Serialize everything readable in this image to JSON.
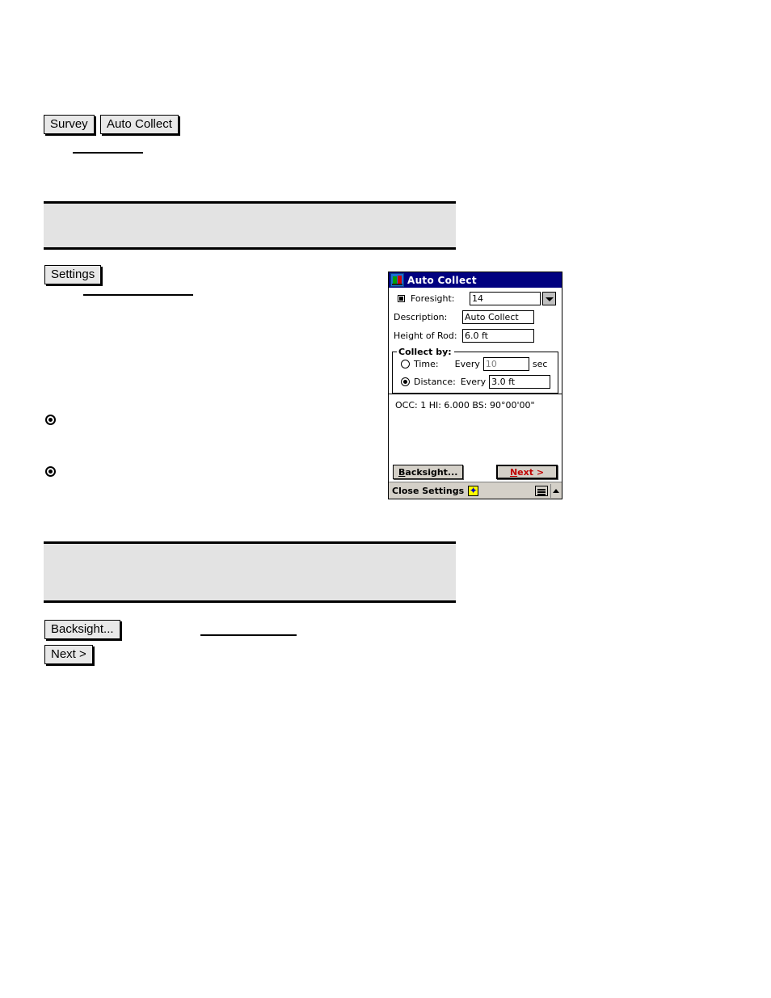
{
  "document": {
    "breadcrumb_buttons": [
      {
        "label": "Survey",
        "name": "survey-button"
      },
      {
        "label": "Auto Collect",
        "name": "auto-collect-button"
      }
    ],
    "settings_button": {
      "label": "Settings"
    },
    "footer_buttons": [
      {
        "label": "Backsight...",
        "name": "backsight-doc-button"
      },
      {
        "label": "Next >",
        "name": "next-doc-button"
      }
    ]
  },
  "dialog": {
    "title": "Auto Collect",
    "title_icon": "survey-app-icon",
    "fields": {
      "foresight": {
        "label": "Foresight:",
        "value": "14",
        "checkbox_checked": true,
        "dropdown_icon": "chevron-down-icon"
      },
      "description": {
        "label": "Description:",
        "value": "Auto Collect"
      },
      "height_of_rod": {
        "label": "Height of Rod:",
        "value": "6.0 ft"
      }
    },
    "collect_by": {
      "legend": "Collect by:",
      "options": [
        {
          "label": "Time:",
          "selected": false,
          "every_label": "Every",
          "value": "10",
          "unit": "sec",
          "disabled": true
        },
        {
          "label": "Distance:",
          "selected": true,
          "every_label": "Every",
          "value": "3.0 ft",
          "unit": "",
          "disabled": false
        }
      ]
    },
    "status_line": "OCC: 1  HI: 6.000  BS: 90°00'00\"",
    "buttons": {
      "backsight": {
        "label": "Backsight...",
        "accel": "B"
      },
      "next": {
        "label": "Next >",
        "accel": "N",
        "is_default": true
      }
    },
    "taskbar": {
      "label": "Close Settings",
      "star_icon": "star-icon",
      "keyboard_icon": "keyboard-icon",
      "updown_icon": "chevron-up-icon"
    }
  },
  "colors": {
    "titlebar": "#000080",
    "dialog_face": "#d4d0c8",
    "note_box": "#e3e3e3",
    "default_button_text": "#c00000",
    "star_yellow": "#ffff00"
  }
}
